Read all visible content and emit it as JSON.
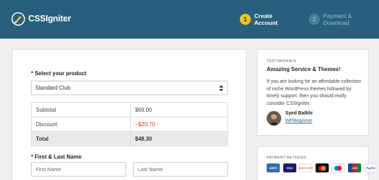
{
  "brand": {
    "logo_text": "CSSIgniter"
  },
  "steps": [
    {
      "num": "1",
      "label": "Create Account"
    },
    {
      "num": "2",
      "label": "Payment & Download"
    }
  ],
  "form": {
    "product_label": "* Select your product",
    "product_selected": "Standard Club",
    "summary": [
      {
        "label": "Subtotal",
        "value": "$69.00"
      },
      {
        "label": "Discount",
        "value": "−$20.70"
      },
      {
        "label": "Total",
        "value": "$48.30"
      }
    ],
    "name_label": "* First & Last Name",
    "first_name_placeholder": "First Name",
    "last_name_placeholder": "Last Name"
  },
  "testimonials": {
    "section_title": "TESTIMONIALS",
    "headline": "Amazing Service & Themes!",
    "body": "If you are looking for an affordable collection of niche WordPress themes followed by timely support, then you should really consider CSSIgniter.",
    "author": "Syed Balkhi",
    "author_site": "WPBeginner"
  },
  "payment": {
    "section_title": "PAYMENT METHODS",
    "methods": [
      "AMEX",
      "VISA",
      "DISCOVER",
      "Mastercard",
      "Maestro",
      "JCB",
      "PayPal"
    ]
  },
  "colors": {
    "header": "#275f7d",
    "accent": "#f4c21e",
    "discount": "#d9302b",
    "link": "#2f6d98"
  }
}
